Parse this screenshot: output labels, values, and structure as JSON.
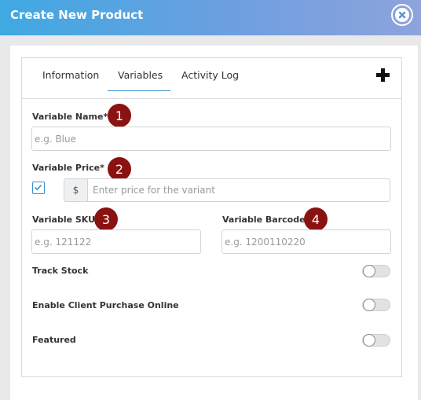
{
  "dialog": {
    "title": "Create New Product"
  },
  "tabs": [
    {
      "label": "Information"
    },
    {
      "label": "Variables",
      "active": true
    },
    {
      "label": "Activity Log"
    }
  ],
  "form": {
    "variable_name": {
      "label": "Variable Name*",
      "placeholder": "e.g. Blue"
    },
    "variable_price": {
      "label": "Variable Price*",
      "currency": "$",
      "placeholder": "Enter price for the variant",
      "checked": true
    },
    "variable_sku": {
      "label": "Variable SKU",
      "placeholder": "e.g. 121122"
    },
    "variable_barcode": {
      "label": "Variable Barcode",
      "placeholder": "e.g. 1200110220"
    },
    "track_stock": {
      "label": "Track Stock",
      "enabled": false
    },
    "client_purchase": {
      "label": "Enable Client Purchase Online",
      "enabled": false
    },
    "featured": {
      "label": "Featured",
      "enabled": false
    }
  },
  "badges": [
    "1",
    "2",
    "3",
    "4"
  ],
  "icons": {
    "close": "close-icon",
    "add": "plus-icon",
    "check": "check-icon"
  },
  "colors": {
    "header_start": "#3fa9e2",
    "header_end": "#8ea3dc",
    "badge": "#8b1212",
    "accent": "#3a8fd0"
  }
}
